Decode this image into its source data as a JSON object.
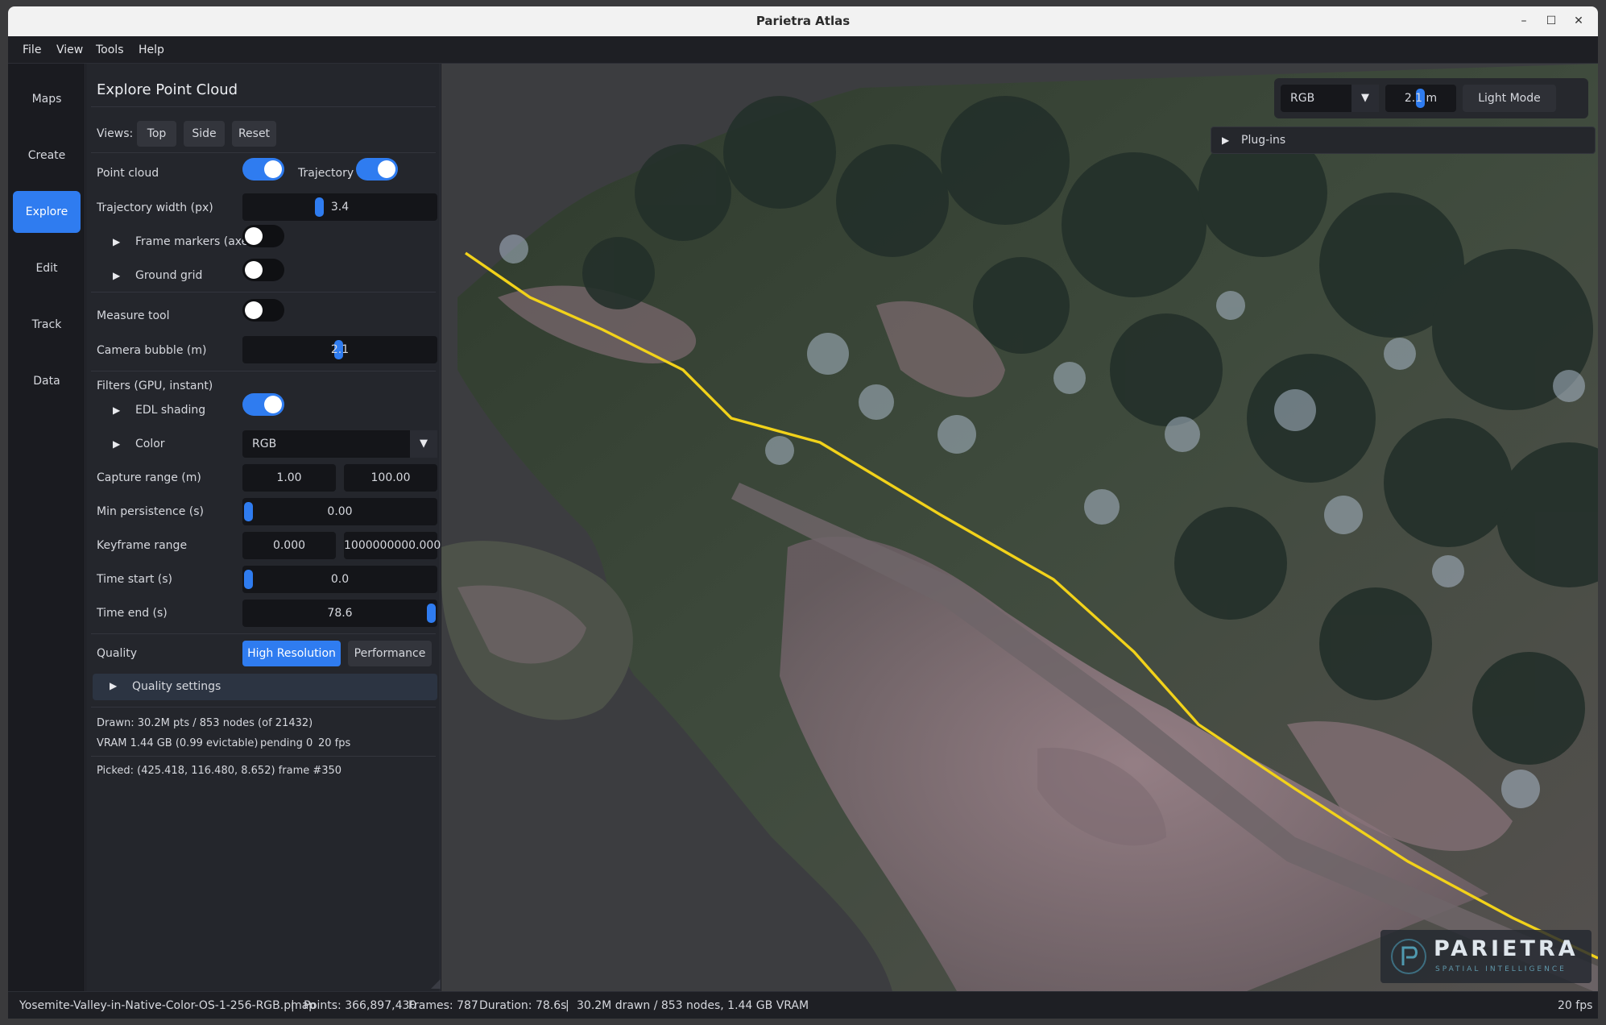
{
  "window": {
    "title": "Parietra Atlas",
    "minimize": "–",
    "maximize": "☐",
    "close": "✕"
  },
  "menu": [
    "File",
    "View",
    "Tools",
    "Help"
  ],
  "rail": [
    "Maps",
    "Create",
    "Explore",
    "Edit",
    "Track",
    "Data"
  ],
  "rail_active": "Explore",
  "panel": {
    "title": "Explore Point Cloud",
    "views_label": "Views:",
    "views": [
      "Top",
      "Side",
      "Reset"
    ],
    "point_cloud_label": "Point cloud",
    "point_cloud_on": true,
    "trajectory_label": "Trajectory",
    "trajectory_on": true,
    "trajectory_width_label": "Trajectory width (px)",
    "trajectory_width_value": "3.4",
    "frame_markers_label": "Frame markers (axes)",
    "frame_markers_on": false,
    "ground_grid_label": "Ground grid",
    "ground_grid_on": false,
    "measure_tool_label": "Measure tool",
    "measure_tool_on": false,
    "camera_bubble_label": "Camera bubble (m)",
    "camera_bubble_value": "2.1",
    "filters_label": "Filters (GPU, instant)",
    "edl_label": "EDL shading",
    "edl_on": true,
    "color_label": "Color",
    "color_value": "RGB",
    "capture_range_label": "Capture range (m)",
    "capture_range_min": "1.00",
    "capture_range_max": "100.00",
    "min_persistence_label": "Min persistence (s)",
    "min_persistence_value": "0.00",
    "keyframe_range_label": "Keyframe range",
    "keyframe_min": "0.000",
    "keyframe_max": "1000000000.000",
    "time_start_label": "Time start (s)",
    "time_start_value": "0.0",
    "time_end_label": "Time end (s)",
    "time_end_value": "78.6",
    "quality_label": "Quality",
    "quality_options": [
      "High Resolution",
      "Performance"
    ],
    "quality_selected": "High Resolution",
    "quality_settings_label": "Quality settings",
    "stats_drawn": "Drawn: 30.2M pts / 853 nodes (of 21432)",
    "stats_vram": "VRAM 1.44 GB (0.99 evictable)",
    "stats_pending": "pending 0",
    "stats_fps": "20 fps",
    "picked": "Picked: (425.418, 116.480, 8.652)  frame #350"
  },
  "viewport": {
    "color_mode": "RGB",
    "bubble_value": "2.1 m",
    "light_mode_label": "Light Mode",
    "plugins_label": "Plug-ins",
    "logo_text": "PARIETRA",
    "logo_sub": "SPATIAL INTELLIGENCE"
  },
  "status": {
    "file": "Yosemite-Valley-in-Native-Color-OS-1-256-RGB.pmap",
    "points": "Points: 366,897,430",
    "frames": "Frames: 787",
    "duration": "Duration: 78.6s",
    "drawn": "30.2M drawn / 853 nodes, 1.44 GB VRAM",
    "fps": "20 fps",
    "separator": "|"
  },
  "colors": {
    "accent": "#2f7cf0",
    "trajectory": "#f2d21a"
  }
}
